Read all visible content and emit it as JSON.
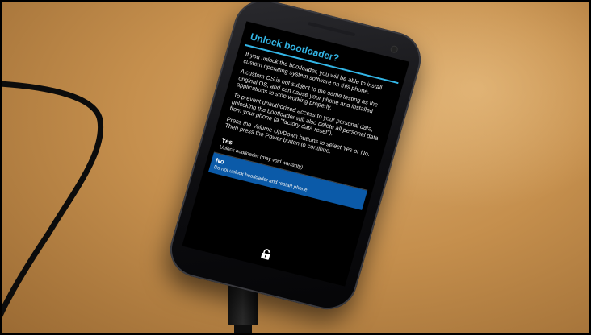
{
  "screen": {
    "title": "Unlock bootloader?",
    "paragraphs": [
      "If you unlock the bootloader, you will be able to install custom operating system software on this phone.",
      "A custom OS is not subject to the same testing as the original OS, and can cause your phone and installed applications to stop working properly.",
      "To prevent unauthorized access to your personal data, unlocking the bootloader will also delete all personal data from your phone (a \"factory data reset\").",
      "Press the Volume Up/Down buttons to select Yes or No. Then press the Power button to continue."
    ],
    "options": [
      {
        "label": "Yes",
        "description": "Unlock bootloader (may void warranty)",
        "selected": false
      },
      {
        "label": "No",
        "description": "Do not unlock bootloader and restart phone",
        "selected": true
      }
    ],
    "footer_icon": "unlocked-padlock-icon"
  },
  "colors": {
    "title": "#33b5e5",
    "selection": "#0b5aa8",
    "table": "#c58f4d"
  }
}
